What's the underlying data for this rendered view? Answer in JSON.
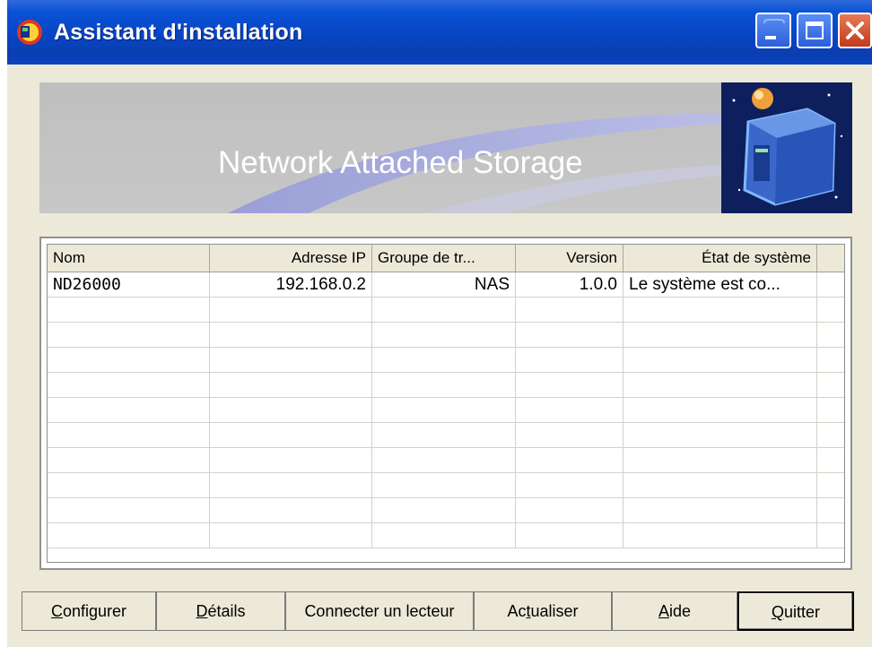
{
  "window": {
    "title": "Assistant d'installation",
    "accent": "#0a52d6"
  },
  "banner": {
    "title": "Network Attached Storage"
  },
  "table": {
    "columns": [
      "Nom",
      "Adresse IP",
      "Groupe de tr...",
      "Version",
      "État de système"
    ],
    "rows": [
      [
        "ND26000",
        "192.168.0.2",
        "NAS",
        "1.0.0",
        "Le système est co..."
      ]
    ]
  },
  "buttons": {
    "configurer": {
      "mn": "C",
      "rest": "onfigurer"
    },
    "details": {
      "mn": "D",
      "rest": "étails"
    },
    "connecter": {
      "label": "Connecter un lecteur"
    },
    "actualiser": {
      "pre": "Ac",
      "mn": "t",
      "rest": "ualiser"
    },
    "aide": {
      "mn": "A",
      "rest": "ide"
    },
    "quitter": {
      "mn": "Q",
      "rest": "uitter"
    }
  }
}
